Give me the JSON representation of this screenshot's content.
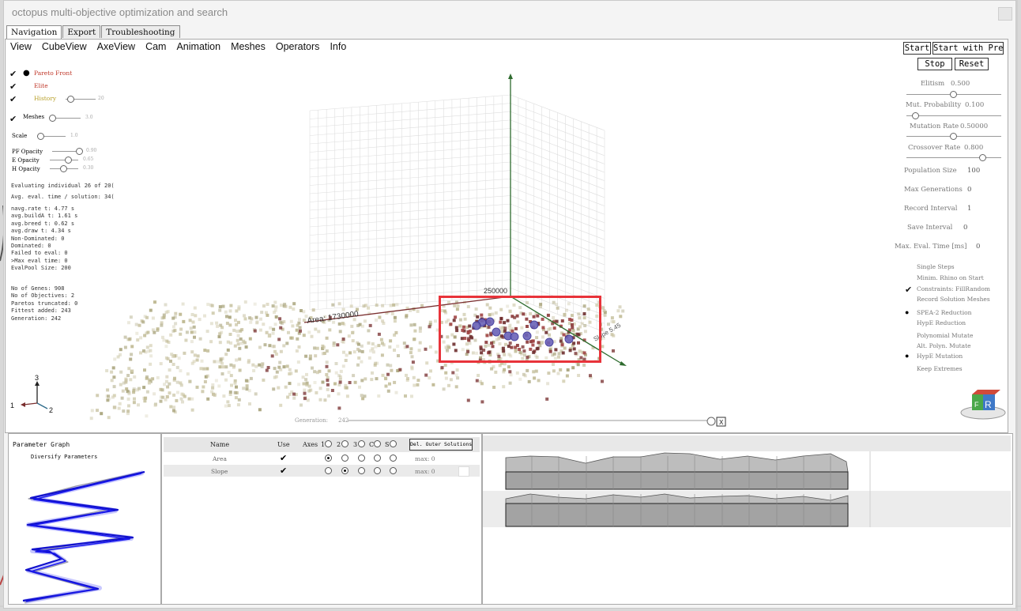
{
  "window": {
    "title": "octopus multi-objective optimization and search"
  },
  "tabs": [
    "Navigation",
    "Export",
    "Troubleshooting"
  ],
  "menu": [
    "View",
    "CubeView",
    "AxeView",
    "Cam",
    "Animation",
    "Meshes",
    "Operators",
    "Info"
  ],
  "left": {
    "pareto_front": "Pareto Front",
    "elite": "Elite",
    "history": "History",
    "history_value": "20",
    "meshes": "Meshes",
    "meshes_value": "3.0",
    "scale": "Scale",
    "scale_value": "1.0",
    "pf_opacity": "PF Opacity",
    "pf_opacity_value": "0.90",
    "e_opacity": "E Opacity",
    "e_opacity_value": "0.65",
    "h_opacity": "H Opacity",
    "h_opacity_value": "0.30",
    "evaluating": "Evaluating individual 26 of 20(",
    "avg_eval": "Avg. eval. time / solution: 34(",
    "stats": [
      "navg.rate t: 4.77 s",
      "avg.buildA t: 1.61 s",
      "avg.breed t: 0.62 s",
      "avg.draw t: 4.34 s",
      "Non-Dominated: 0",
      "Dominated: 0",
      "Failed to eval: 0",
      ">Max eval time: 0",
      "EvalPool Size: 200"
    ],
    "stats2": [
      "No of Genes: 908",
      "No of Objectives: 2",
      "Paretos truncated: 0",
      "Fittest added: 243",
      "Generation: 242"
    ]
  },
  "right": {
    "start": "Start",
    "start_preset": "Start with Prese",
    "stop": "Stop",
    "reset": "Reset",
    "elitism": "Elitism",
    "elitism_value": "0.500",
    "mut_prob": "Mut. Probability",
    "mut_prob_value": "0.100",
    "mut_rate": "Mutation Rate",
    "mut_rate_value": "0.50000",
    "cross_rate": "Crossover Rate",
    "cross_rate_value": "0.800",
    "pop_size": "Population Size",
    "pop_size_value": "100",
    "max_gen": "Max Generations",
    "max_gen_value": "0",
    "rec_int": "Record Interval",
    "rec_int_value": "1",
    "save_int": "Save Interval",
    "save_int_value": "0",
    "max_eval": "Max. Eval. Time [ms]",
    "max_eval_value": "0",
    "options": [
      "Single Steps",
      "Minim. Rhino on Start",
      "Constraints: FillRandom",
      "Record Solution Meshes"
    ],
    "reduction": [
      "SPEA-2 Reduction",
      "HypE Reduction"
    ],
    "mutation": [
      "Polynomial Mutate",
      "Alt. Polyn. Mutate",
      "HypE Mutation"
    ],
    "keep": "Keep Extremes"
  },
  "scene": {
    "area_label": "Area: 1730000",
    "tick_label": "250000",
    "slope_label": "Slope 5.45",
    "generation_label": "Generation:",
    "generation_value": "242",
    "x_btn": "X",
    "axis_1": "1",
    "axis_2": "2",
    "axis_3": "3",
    "cube_letter_r": "R",
    "cube_letter_f": "F"
  },
  "param_graph": {
    "title": "Parameter Graph",
    "subtitle": "Diversify Parameters"
  },
  "table": {
    "col_name": "Name",
    "col_use": "Use",
    "col_axes": "Axes",
    "axes_nums": [
      "1",
      "2",
      "3",
      "C",
      "S"
    ],
    "del_btn": "Del. Outer Solutions",
    "rows": [
      {
        "name": "Area",
        "max": "max: 0"
      },
      {
        "name": "Slope",
        "max": "max: 0"
      }
    ]
  }
}
